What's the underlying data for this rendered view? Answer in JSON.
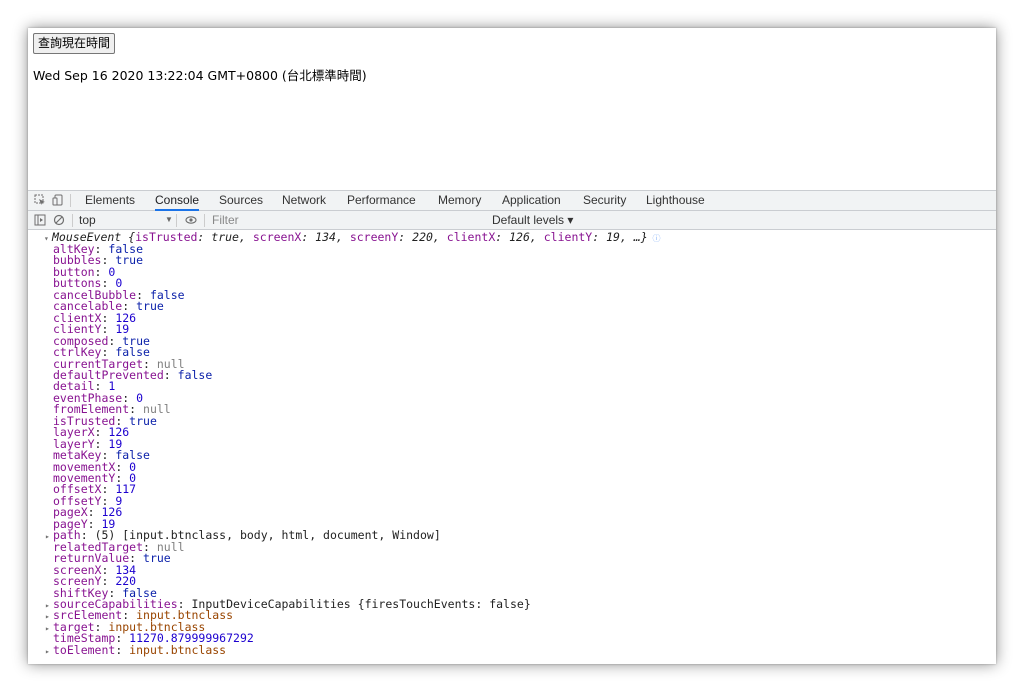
{
  "page": {
    "query_button": "查詢現在時間",
    "time_text": "Wed Sep 16 2020 13:22:04 GMT+0800 (台北標準時間)"
  },
  "devtools": {
    "tabs": [
      "Elements",
      "Console",
      "Sources",
      "Network",
      "Performance",
      "Memory",
      "Application",
      "Security",
      "Lighthouse"
    ],
    "active_tab": "Console",
    "context": "top",
    "filter_placeholder": "Filter",
    "levels": "Default levels ▾",
    "accent": "#1a73e8"
  },
  "console": {
    "header": {
      "type": "MouseEvent",
      "preview": [
        {
          "key": "isTrusted",
          "value": "true",
          "kind": "bool"
        },
        {
          "key": "screenX",
          "value": "134",
          "kind": "num"
        },
        {
          "key": "screenY",
          "value": "220",
          "kind": "num"
        },
        {
          "key": "clientX",
          "value": "126",
          "kind": "num"
        },
        {
          "key": "clientY",
          "value": "19",
          "kind": "num"
        }
      ],
      "ellipsis": "…"
    },
    "props": [
      {
        "key": "altKey",
        "value": "false",
        "kind": "bool"
      },
      {
        "key": "bubbles",
        "value": "true",
        "kind": "bool"
      },
      {
        "key": "button",
        "value": "0",
        "kind": "num"
      },
      {
        "key": "buttons",
        "value": "0",
        "kind": "num"
      },
      {
        "key": "cancelBubble",
        "value": "false",
        "kind": "bool"
      },
      {
        "key": "cancelable",
        "value": "true",
        "kind": "bool"
      },
      {
        "key": "clientX",
        "value": "126",
        "kind": "num"
      },
      {
        "key": "clientY",
        "value": "19",
        "kind": "num"
      },
      {
        "key": "composed",
        "value": "true",
        "kind": "bool"
      },
      {
        "key": "ctrlKey",
        "value": "false",
        "kind": "bool"
      },
      {
        "key": "currentTarget",
        "value": "null",
        "kind": "null"
      },
      {
        "key": "defaultPrevented",
        "value": "false",
        "kind": "bool"
      },
      {
        "key": "detail",
        "value": "1",
        "kind": "num"
      },
      {
        "key": "eventPhase",
        "value": "0",
        "kind": "num"
      },
      {
        "key": "fromElement",
        "value": "null",
        "kind": "null"
      },
      {
        "key": "isTrusted",
        "value": "true",
        "kind": "bool"
      },
      {
        "key": "layerX",
        "value": "126",
        "kind": "num"
      },
      {
        "key": "layerY",
        "value": "19",
        "kind": "num"
      },
      {
        "key": "metaKey",
        "value": "false",
        "kind": "bool"
      },
      {
        "key": "movementX",
        "value": "0",
        "kind": "num"
      },
      {
        "key": "movementY",
        "value": "0",
        "kind": "num"
      },
      {
        "key": "offsetX",
        "value": "117",
        "kind": "num"
      },
      {
        "key": "offsetY",
        "value": "9",
        "kind": "num"
      },
      {
        "key": "pageX",
        "value": "126",
        "kind": "num"
      },
      {
        "key": "pageY",
        "value": "19",
        "kind": "num"
      },
      {
        "key": "path",
        "value": "(5) [input.btnclass, body, html, document, Window]",
        "kind": "array",
        "expandable": true
      },
      {
        "key": "relatedTarget",
        "value": "null",
        "kind": "null"
      },
      {
        "key": "returnValue",
        "value": "true",
        "kind": "bool"
      },
      {
        "key": "screenX",
        "value": "134",
        "kind": "num"
      },
      {
        "key": "screenY",
        "value": "220",
        "kind": "num"
      },
      {
        "key": "shiftKey",
        "value": "false",
        "kind": "bool"
      },
      {
        "key": "sourceCapabilities",
        "value": "InputDeviceCapabilities {firesTouchEvents: false}",
        "kind": "obj",
        "expandable": true
      },
      {
        "key": "srcElement",
        "value": "input.btnclass",
        "kind": "el",
        "expandable": true
      },
      {
        "key": "target",
        "value": "input.btnclass",
        "kind": "el",
        "expandable": true
      },
      {
        "key": "timeStamp",
        "value": "11270.879999967292",
        "kind": "num"
      },
      {
        "key": "toElement",
        "value": "input.btnclass",
        "kind": "el",
        "expandable": true
      }
    ]
  }
}
